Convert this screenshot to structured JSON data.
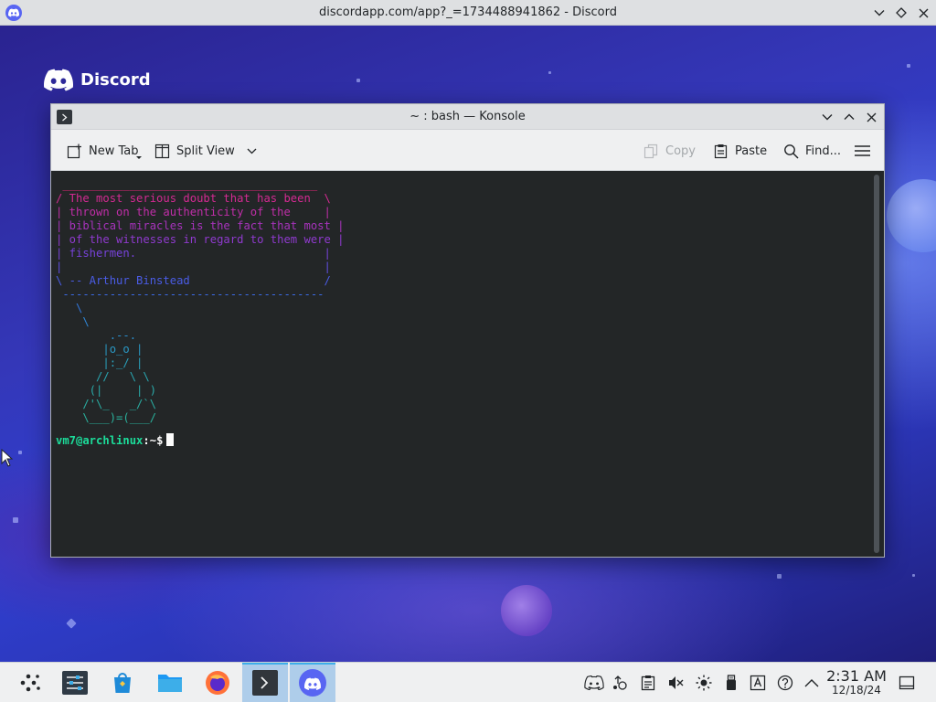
{
  "window": {
    "title": "discordapp.com/app?_=1734488941862 - Discord"
  },
  "desktop": {
    "brand_name": "Discord"
  },
  "konsole": {
    "title": "~ : bash — Konsole",
    "toolbar": {
      "new_tab": "New Tab",
      "split_view": "Split View",
      "copy": "Copy",
      "paste": "Paste",
      "find": "Find..."
    },
    "terminal": {
      "output_lines": [
        " ______________________________________",
        "/ The most serious doubt that has been  \\",
        "| thrown on the authenticity of the     |",
        "| biblical miracles is the fact that most |",
        "| of the witnesses in regard to them were |",
        "| fishermen.                            |",
        "|                                       |",
        "\\ -- Arthur Binstead                    /",
        " ---------------------------------------",
        "   \\",
        "    \\",
        "        .--.",
        "       |o_o |",
        "       |:_/ |",
        "      //   \\ \\",
        "     (|     | )",
        "    /'\\_   _/`\\",
        "    \\___)=(___/"
      ],
      "prompt_user": "vm7@archlinux",
      "prompt_path": ":~$"
    },
    "colors": {
      "background": "#232627",
      "prompt": "#1cdc9a"
    }
  },
  "taskbar": {
    "apps": [
      {
        "name": "Application Launcher",
        "icon": "kde-launcher-icon"
      },
      {
        "name": "System Settings",
        "icon": "settings-icon"
      },
      {
        "name": "Discover",
        "icon": "store-icon"
      },
      {
        "name": "Dolphin",
        "icon": "folder-icon"
      },
      {
        "name": "Firefox",
        "icon": "firefox-icon"
      },
      {
        "name": "Konsole",
        "icon": "terminal-icon"
      },
      {
        "name": "Discord",
        "icon": "discord-icon"
      }
    ],
    "clock": {
      "time": "2:31 AM",
      "date": "12/18/24"
    }
  }
}
